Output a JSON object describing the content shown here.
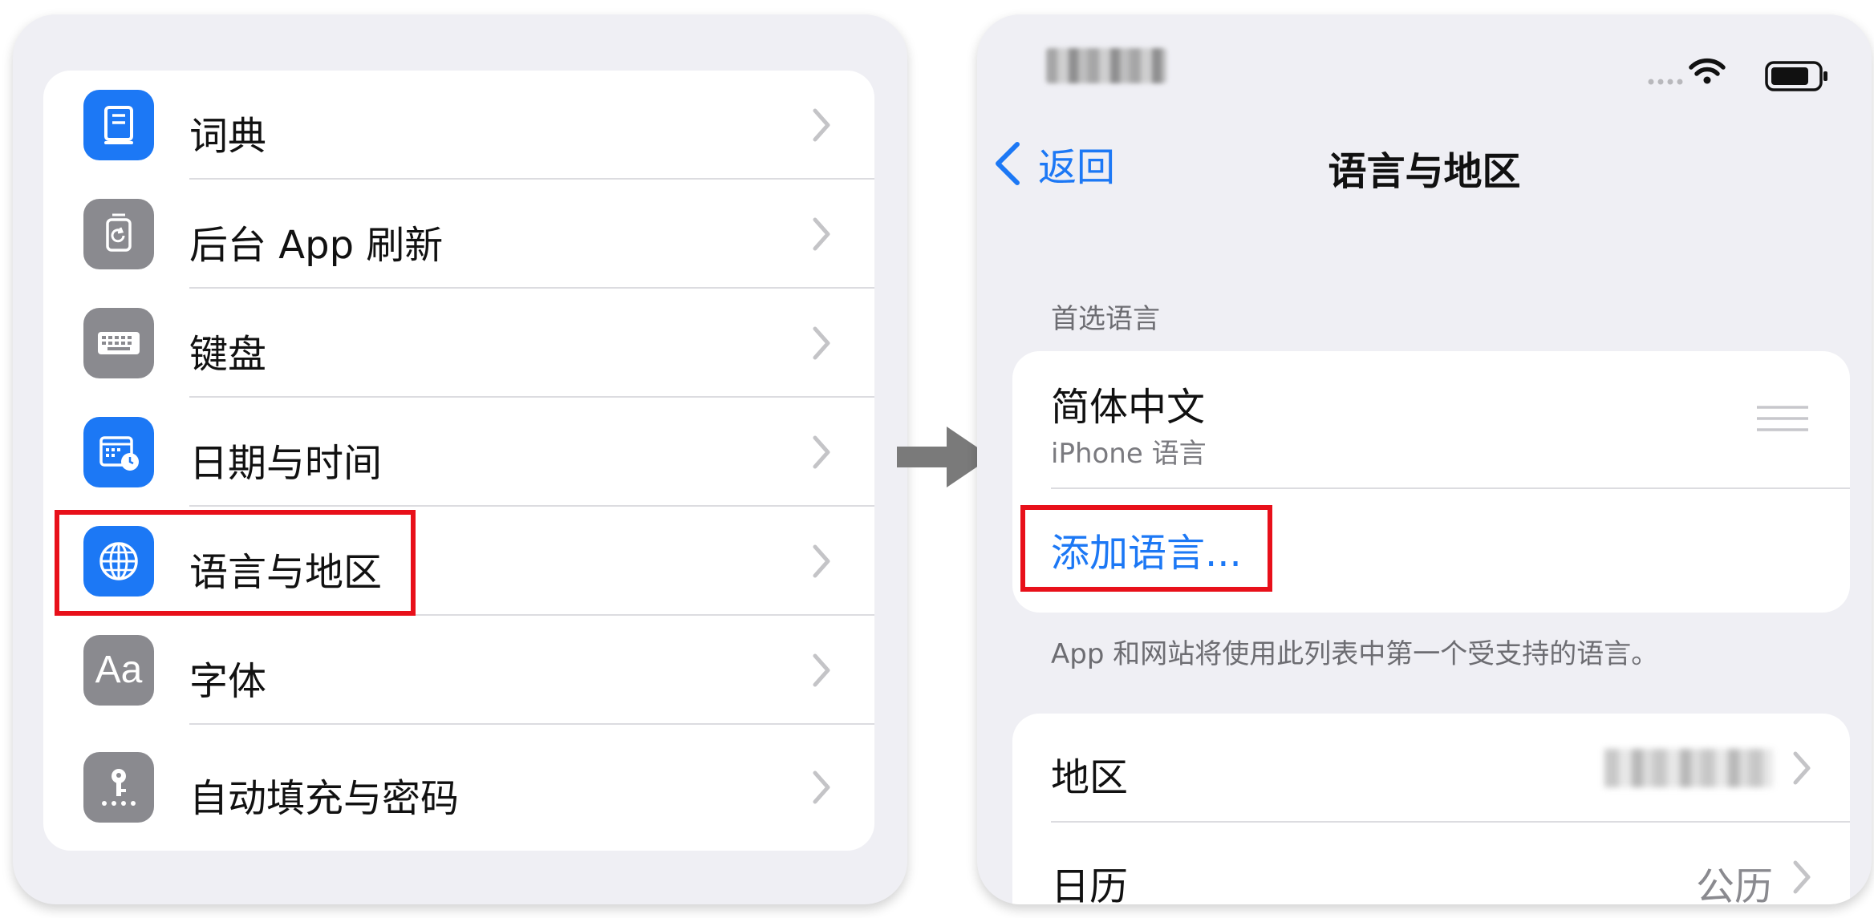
{
  "settings_list": {
    "items": [
      {
        "label": "词典",
        "icon": "dictionary-icon"
      },
      {
        "label": "后台 App 刷新",
        "icon": "background-refresh-icon"
      },
      {
        "label": "键盘",
        "icon": "keyboard-icon"
      },
      {
        "label": "日期与时间",
        "icon": "date-time-icon"
      },
      {
        "label": "语言与地区",
        "icon": "globe-icon"
      },
      {
        "label": "字体",
        "icon": "fonts-icon"
      },
      {
        "label": "自动填充与密码",
        "icon": "autofill-passwords-icon"
      }
    ]
  },
  "language_region": {
    "nav": {
      "back_label": "返回",
      "title": "语言与地区"
    },
    "preferred_section_header": "首选语言",
    "languages": [
      {
        "name": "简体中文",
        "subtitle": "iPhone 语言"
      }
    ],
    "add_language_label": "添加语言...",
    "section_footer": "App 和网站将使用此列表中第一个受支持的语言。",
    "region_row": {
      "label": "地区",
      "value": ""
    },
    "calendar_row": {
      "label": "日历",
      "value": "公历"
    }
  },
  "colors": {
    "accent_blue": "#1c78f5",
    "icon_gray": "#8a8a8f",
    "highlight_red": "#e8101a",
    "arrow_gray": "#7a7a7a"
  }
}
